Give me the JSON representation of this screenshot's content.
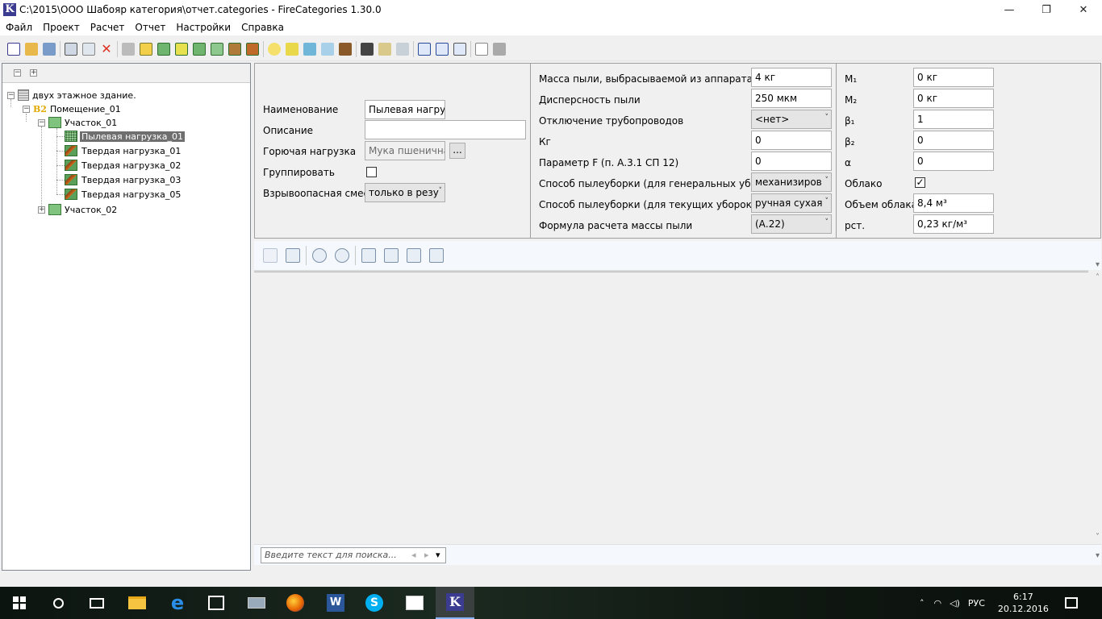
{
  "window": {
    "title": "C:\\2015\\ООО Шабояр категория\\отчет.categories - FireCategories 1.30.0",
    "icon_letter": "K",
    "minimize": "—",
    "restore": "❐",
    "close": "✕"
  },
  "menu": [
    "Файл",
    "Проект",
    "Расчет",
    "Отчет",
    "Настройки",
    "Справка"
  ],
  "tree": {
    "collapse_all": "−",
    "expand_all": "+",
    "root": "двух этажное здание.",
    "room_badge": "В2",
    "room": "Помещение_01",
    "section1": "Участок_01",
    "items": [
      "Пылевая нагрузка_01",
      "Твердая нагрузка_01",
      "Твердая нагрузка_02",
      "Твердая нагрузка_03",
      "Твердая нагрузка_05"
    ],
    "section2": "Участок_02"
  },
  "form": {
    "name_label": "Наименование",
    "name_value": "Пылевая нагрузк",
    "desc_label": "Описание",
    "desc_value": "",
    "fuel_label": "Горючая нагрузка",
    "fuel_value": "Мука пшеничная",
    "fuel_button": "...",
    "group_label": "Группировать",
    "mix_label": "Взрывоопасная смесь",
    "mix_value": "только в резу"
  },
  "params": {
    "mass_label": "Масса пыли, выбрасываемой из аппарата",
    "mass_value": "4 кг",
    "disp_label": "Дисперсность пыли",
    "disp_value": "250 мкм",
    "pipe_label": "Отключение трубопроводов",
    "pipe_value": "<нет>",
    "kg_label": "Кг",
    "kg_value": "0",
    "f_label": "Параметр F (п. А.3.1 СП 12)",
    "f_value": "0",
    "gen_label": "Способ пылеуборки (для генеральных уборок)",
    "gen_value": "механизиров",
    "cur_label": "Способ пылеуборки (для текущих уборок)",
    "cur_value": "ручная сухая",
    "formula_label": "Формула расчета массы пыли",
    "formula_value": "(А.22)"
  },
  "coeffs": {
    "m1_label": "М₁",
    "m1_value": "0 кг",
    "m2_label": "М₂",
    "m2_value": "0 кг",
    "b1_label": "β₁",
    "b1_value": "1",
    "b2_label": "β₂",
    "b2_value": "0",
    "a_label": "α",
    "a_value": "0",
    "cloud_label": "Облако",
    "cloud_checked": "✓",
    "vol_label": "Объем облака",
    "vol_value": "8,4 м³",
    "rho_label": "рст.",
    "rho_value": "0,23 кг/м³"
  },
  "report": {
    "search_placeholder": "Введите текст для поиска...",
    "prev": "◂",
    "next": "▸",
    "dropdown": "▾"
  },
  "taskbar": {
    "lang": "РУС",
    "time": "6:17",
    "date": "20.12.2016"
  }
}
